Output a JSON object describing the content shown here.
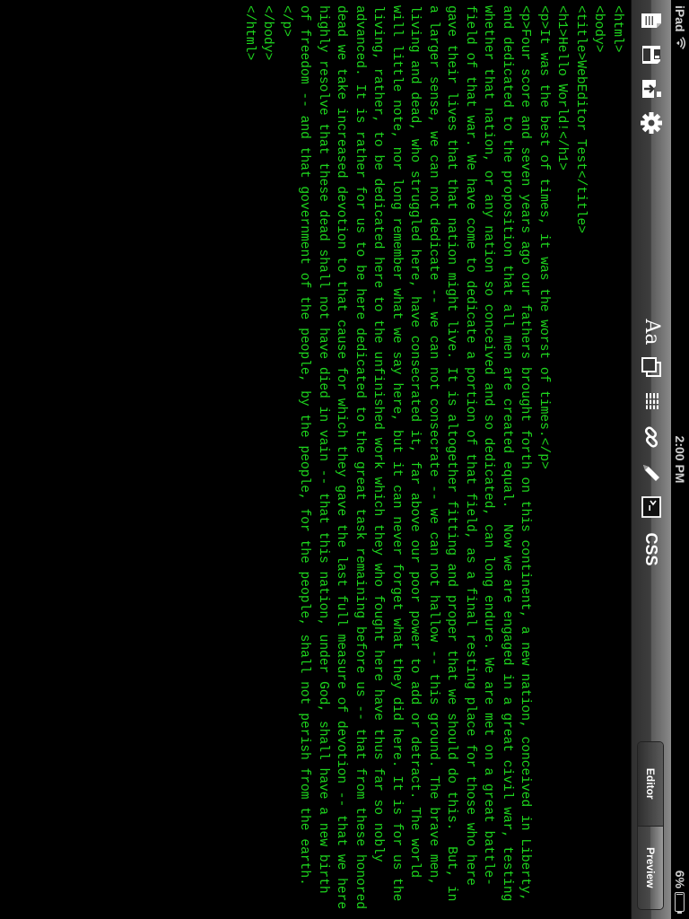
{
  "status_bar": {
    "carrier": "iPad",
    "time": "2:00 PM",
    "battery": "6%",
    "battery_level": 0.06
  },
  "toolbar": {
    "icons": {
      "new": "new-document-icon",
      "save": "save-icon",
      "export": "export-icon",
      "settings": "gear-icon",
      "font": "font-size-icon",
      "copy": "copy-icon",
      "list": "list-icon",
      "link": "link-icon",
      "edit": "pencil-icon",
      "terminal": "terminal-icon"
    },
    "font_label": "Aa",
    "css_label": "CSS",
    "segments": [
      {
        "label": "Editor",
        "selected": true
      },
      {
        "label": "Preview",
        "selected": false
      }
    ]
  },
  "editor": {
    "text_color": "#1ed61e",
    "lines": [
      "<html>",
      "<body>",
      "<title>WebEditor Test</title>",
      "<h1>Hello World!</h1>",
      "<p>It was the best of times, it was the worst of times.</p>",
      "<p>Four score and seven years ago our fathers brought forth on this continent, a new nation, conceived in Liberty, and dedicated to the proposition that all men are created equal.  Now we are engaged in a great civil war, testing whether that nation, or any nation so conceived and so dedicated, can long endure. We are met on a great battle-field of that war. We have come to dedicate a portion of that field, as a final resting place for those who here gave their lives that that nation might live. It is altogether fitting and proper that we should do this.  But, in a larger sense, we can not dedicate -- we can not consecrate -- we can not hallow -- this ground. The brave men, living and dead, who struggled here, have consecrated it, far above our poor power to add or detract. The world will little note, nor long remember what we say here, but it can never forget what they did here. It is for us the living, rather, to be dedicated here to the unfinished work which they who fought here have thus far so nobly advanced. It is rather for us to be here dedicated to the great task remaining before us -- that from these honored dead we take increased devotion to that cause for which they gave the last full measure of devotion -- that we here highly resolve that these dead shall not have died in vain -- that this nation, under God, shall have a new birth of freedom -- and that government of the people, by the people, for the people, shall not perish from the earth.</p>",
      "</body>",
      "</html>"
    ]
  }
}
